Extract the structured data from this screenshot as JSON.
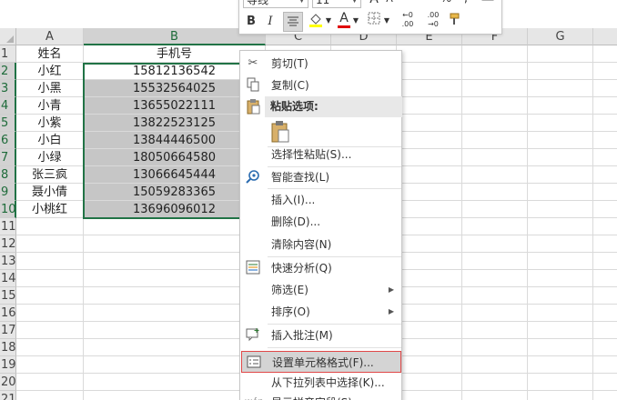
{
  "toolbar": {
    "font_name": "等线",
    "font_size": "11",
    "grow_font": "A",
    "shrink_font": "A",
    "percent": "%",
    "comma": ",",
    "bold": "B",
    "italic": "I",
    "font_color_letter": "A",
    "inc_decimal": "←0 .00",
    "dec_decimal": ".00 →0",
    "highlight_color": "#ffff00",
    "font_color": "#e00000"
  },
  "columns": [
    "A",
    "B",
    "C",
    "D",
    "E",
    "F",
    "G"
  ],
  "rows": [
    "1",
    "2",
    "3",
    "4",
    "5",
    "6",
    "7",
    "8",
    "9",
    "10",
    "11",
    "12",
    "13",
    "14",
    "15",
    "16",
    "17",
    "18",
    "19",
    "20",
    "21"
  ],
  "table": {
    "header_name": "姓名",
    "header_phone": "手机号",
    "names": [
      "小红",
      "小黑",
      "小青",
      "小紫",
      "小白",
      "小绿",
      "张三疯",
      "聂小倩",
      "小桃红"
    ],
    "phones": [
      "15812136542",
      "15532564025",
      "13655022111",
      "13822523125",
      "13844446500",
      "18050664580",
      "13066645444",
      "15059283365",
      "13696096012"
    ]
  },
  "menu": {
    "cut": "剪切(T)",
    "copy": "复制(C)",
    "paste_options": "粘贴选项:",
    "paste_special": "选择性粘贴(S)...",
    "smart_lookup": "智能查找(L)",
    "insert": "插入(I)...",
    "delete": "删除(D)...",
    "clear_contents": "清除内容(N)",
    "quick_analysis": "快速分析(Q)",
    "filter": "筛选(E)",
    "sort": "排序(O)",
    "insert_comment": "插入批注(M)",
    "format_cells": "设置单元格格式(F)...",
    "pick_from_list": "从下拉列表中选择(K)...",
    "show_phonetic": "显示拼音字段(S)"
  },
  "colors": {
    "selection_border": "#217346",
    "highlight_fill": "#c6c6c6",
    "focus_outline": "#e04848"
  }
}
